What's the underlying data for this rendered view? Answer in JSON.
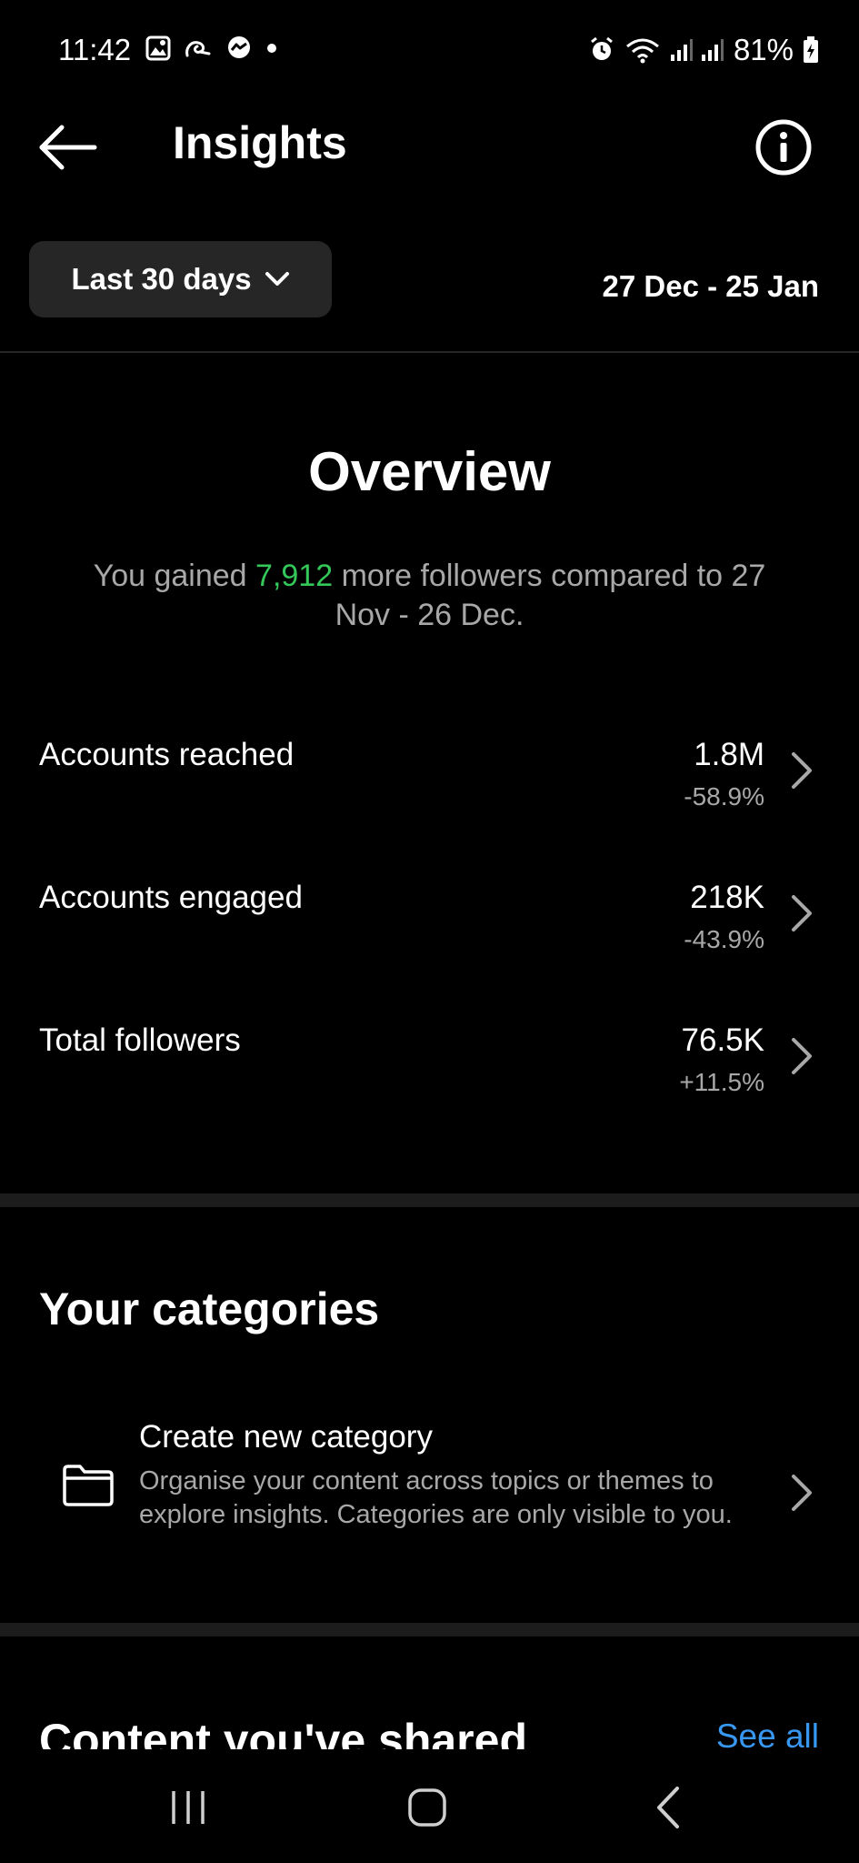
{
  "status_bar": {
    "time": "11:42",
    "battery": "81%",
    "left_icons": [
      "gallery-icon",
      "mail-icon",
      "messenger-icon",
      "dot-icon"
    ],
    "right_icons": [
      "alarm-icon",
      "wifi-icon",
      "signal-icon",
      "signal-icon",
      "battery-icon"
    ]
  },
  "header": {
    "title": "Insights",
    "back_icon": "arrow-left-icon",
    "info_icon": "info-icon"
  },
  "filter": {
    "range_label": "Last 30 days",
    "dates": "27 Dec - 25 Jan"
  },
  "overview": {
    "title": "Overview",
    "summary_prefix": "You gained ",
    "summary_highlight": "7,912",
    "summary_suffix": " more followers compared to 27 Nov - 26 Dec.",
    "metrics": [
      {
        "label": "Accounts reached",
        "value": "1.8M",
        "change": "-58.9%"
      },
      {
        "label": "Accounts engaged",
        "value": "218K",
        "change": "-43.9%"
      },
      {
        "label": "Total followers",
        "value": "76.5K",
        "change": "+11.5%"
      }
    ]
  },
  "categories": {
    "title": "Your categories",
    "create_title": "Create new category",
    "create_description": "Organise your content across topics or themes to explore insights. Categories are only visible to you."
  },
  "content_shared": {
    "title": "Content you've shared",
    "see_all": "See all"
  },
  "colors": {
    "background": "#000000",
    "accent_green": "#34c759",
    "link_blue": "#3897f0",
    "muted_text": "#a8a8a8"
  }
}
